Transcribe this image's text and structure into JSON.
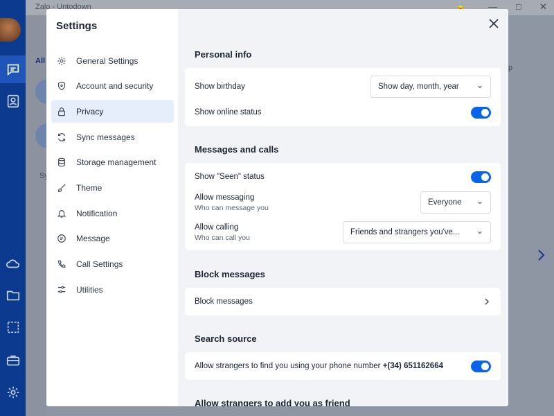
{
  "window": {
    "title": "Zalo - Untodown"
  },
  "settings": {
    "title": "Settings",
    "nav": [
      {
        "label": "General Settings",
        "icon": "gear-icon"
      },
      {
        "label": "Account and security",
        "icon": "shield-icon"
      },
      {
        "label": "Privacy",
        "icon": "lock-icon",
        "active": true
      },
      {
        "label": "Sync messages",
        "icon": "sync-icon"
      },
      {
        "label": "Storage management",
        "icon": "database-icon"
      },
      {
        "label": "Theme",
        "icon": "brush-icon"
      },
      {
        "label": "Notification",
        "icon": "bell-icon"
      },
      {
        "label": "Message",
        "icon": "chat-icon"
      },
      {
        "label": "Call Settings",
        "icon": "phone-icon"
      },
      {
        "label": "Utilities",
        "icon": "sliders-icon"
      }
    ]
  },
  "background": {
    "all_tab": "All",
    "sy_label": "Sy",
    "p_label": "p"
  },
  "privacy": {
    "personal_info": {
      "title": "Personal info",
      "show_birthday": {
        "label": "Show birthday",
        "value": "Show day, month, year"
      },
      "show_online_status": {
        "label": "Show online status",
        "enabled": true
      }
    },
    "messages_calls": {
      "title": "Messages and calls",
      "show_seen": {
        "label": "Show \"Seen\" status",
        "enabled": true
      },
      "allow_messaging": {
        "label": "Allow messaging",
        "sublabel": "Who can message you",
        "value": "Everyone"
      },
      "allow_calling": {
        "label": "Allow calling",
        "sublabel": "Who can call you",
        "value": "Friends and strangers you've..."
      }
    },
    "block_messages": {
      "title": "Block messages",
      "row_label": "Block messages"
    },
    "search_source": {
      "title": "Search source",
      "phone_label": "Allow strangers to find you using your phone number",
      "phone_number": "+(34) 651162664",
      "enabled": true
    },
    "add_friend": {
      "title": "Allow strangers to add you as friend"
    }
  },
  "colors": {
    "accent": "#0a64e8",
    "active_nav": "#e6eefb",
    "left_nav": "#0b3a8f"
  }
}
